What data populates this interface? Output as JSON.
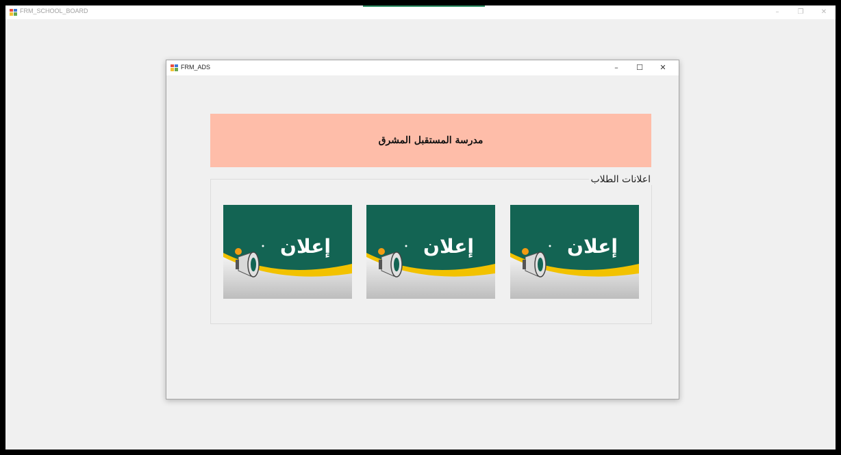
{
  "outer_window": {
    "title": "FRM_SCHOOL_BOARD",
    "controls": {
      "minimize": "–",
      "maximize": "❐",
      "close": "✕"
    }
  },
  "ads_window": {
    "title": "FRM_ADS",
    "controls": {
      "minimize": "–",
      "maximize": "☐",
      "close": "✕"
    }
  },
  "banner": {
    "text": "مدرسة المستقبل المشرق"
  },
  "announcements": {
    "legend": "اعلانات الطلاب",
    "cards": [
      {
        "text": "إعلان"
      },
      {
        "text": "إعلان"
      },
      {
        "text": "إعلان"
      }
    ]
  },
  "colors": {
    "banner_bg": "#febda9",
    "card_green": "#136453",
    "card_yellow": "#f2c200"
  }
}
